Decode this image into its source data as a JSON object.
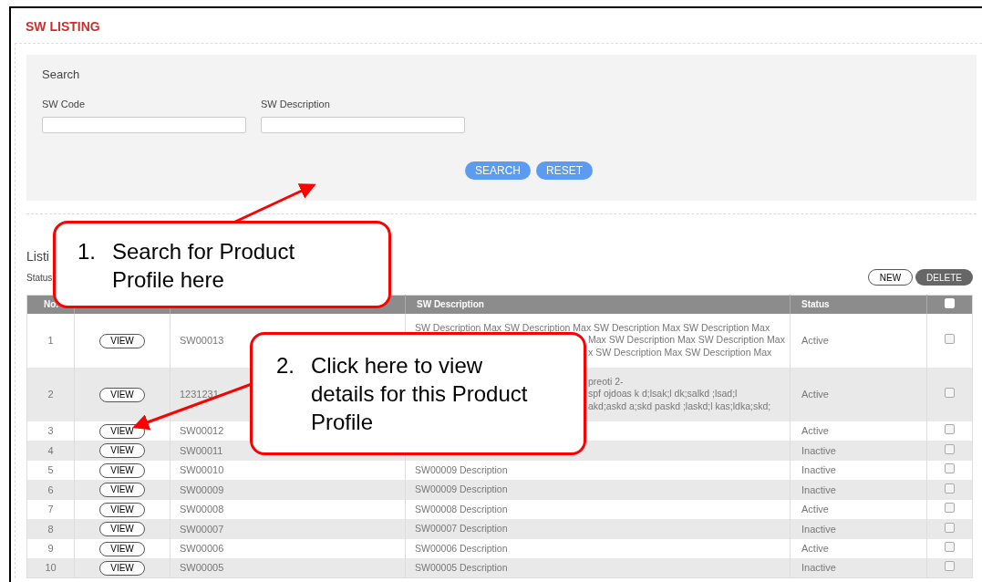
{
  "title": "SW LISTING",
  "search": {
    "heading": "Search",
    "fields": [
      {
        "label": "SW Code"
      },
      {
        "label": "SW Description"
      }
    ],
    "buttons": [
      "SEARCH",
      "RESET"
    ]
  },
  "listing": {
    "heading": "Listi",
    "status_label": "Status",
    "buttons": [
      {
        "label": "NEW",
        "kind": "outline"
      },
      {
        "label": "DELETE",
        "kind": "solid"
      }
    ]
  },
  "table": {
    "columns": {
      "no": "No.",
      "description": "SW Description",
      "status": "Status",
      "select_all_checked": false
    },
    "rows": [
      {
        "no": "1",
        "action": "VIEW",
        "code": "SW00013",
        "description": [
          {
            "text": "SW Description Max SW Description Max SW Description Max SW Description Max",
            "kind": "full"
          },
          {
            "text": "Max SW Description Max SW Description Max",
            "kind": "tail"
          },
          {
            "text": "x SW Description Max SW Description Max",
            "kind": "tail"
          }
        ],
        "status": "Active",
        "checked": false
      },
      {
        "no": "2",
        "action": "VIEW",
        "code": "1231231",
        "description": [
          {
            "text": "preoti 2-",
            "kind": "clipped"
          },
          {
            "text": "spf ojdoas k d;lsak;l dk;salkd ;lsad;l",
            "kind": "clipped"
          },
          {
            "text": "akd;askd a;skd paskd ;laskd;l kas;ldka;skd;",
            "kind": "clipped"
          }
        ],
        "status": "Active",
        "checked": false
      },
      {
        "no": "3",
        "action": "VIEW",
        "code": "SW00012",
        "status": "Active",
        "checked": false
      },
      {
        "no": "4",
        "action": "VIEW",
        "code": "SW00011",
        "status": "Inactive",
        "checked": false
      },
      {
        "no": "5",
        "action": "VIEW",
        "code": "SW00010",
        "description": [
          {
            "text": "SW00009 Description",
            "kind": "full"
          }
        ],
        "status": "Inactive",
        "checked": false
      },
      {
        "no": "6",
        "action": "VIEW",
        "code": "SW00009",
        "description": [
          {
            "text": "SW00009 Description",
            "kind": "full"
          }
        ],
        "status": "Inactive",
        "checked": false
      },
      {
        "no": "7",
        "action": "VIEW",
        "code": "SW00008",
        "description": [
          {
            "text": "SW00008 Description",
            "kind": "full"
          }
        ],
        "status": "Active",
        "checked": false
      },
      {
        "no": "8",
        "action": "VIEW",
        "code": "SW00007",
        "description": [
          {
            "text": "SW00007 Description",
            "kind": "full"
          }
        ],
        "status": "Inactive",
        "checked": false
      },
      {
        "no": "9",
        "action": "VIEW",
        "code": "SW00006",
        "description": [
          {
            "text": "SW00006 Description",
            "kind": "full"
          }
        ],
        "status": "Active",
        "checked": false
      },
      {
        "no": "10",
        "action": "VIEW",
        "code": "SW00005",
        "description": [
          {
            "text": "SW00005 Description",
            "kind": "full"
          }
        ],
        "status": "Inactive",
        "checked": false
      }
    ]
  },
  "callouts": [
    {
      "number": "1.",
      "text": "Search for Product Profile here"
    },
    {
      "number": "2.",
      "text": "Click here to view details for this Product Profile"
    }
  ]
}
